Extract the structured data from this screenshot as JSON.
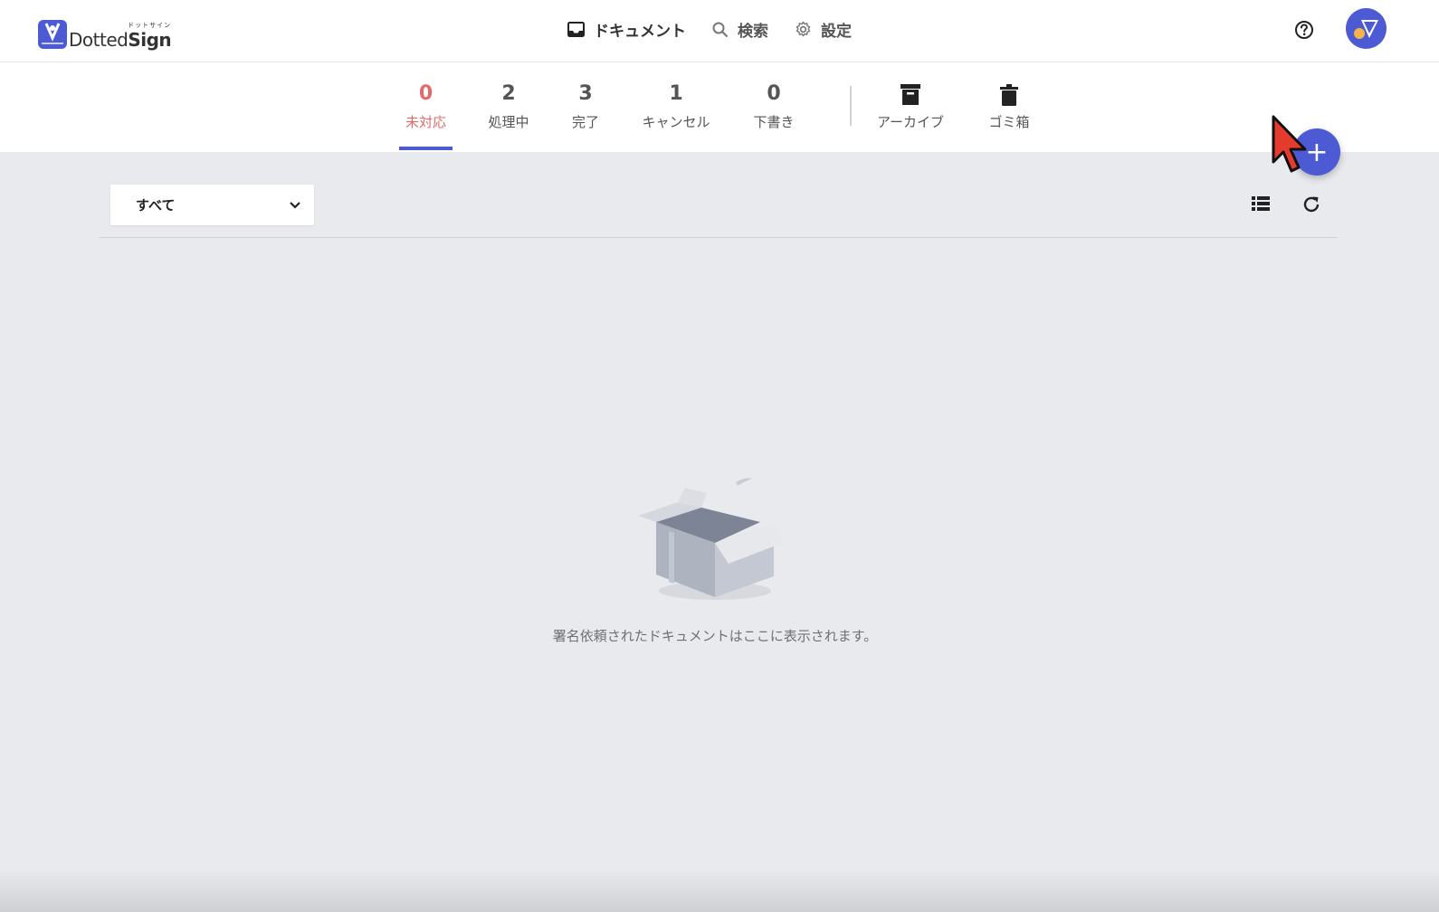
{
  "brand": {
    "kana": "ドットサイン",
    "word_light": "Dotted",
    "word_bold": "Sign"
  },
  "nav": {
    "documents": "ドキュメント",
    "search": "検索",
    "settings": "設定"
  },
  "tabs": [
    {
      "count": "0",
      "label": "未対応"
    },
    {
      "count": "2",
      "label": "処理中"
    },
    {
      "count": "3",
      "label": "完了"
    },
    {
      "count": "1",
      "label": "キャンセル"
    },
    {
      "count": "0",
      "label": "下書き"
    }
  ],
  "folders": [
    {
      "label": "アーカイブ",
      "icon": "archive-icon"
    },
    {
      "label": "ゴミ箱",
      "icon": "trash-icon"
    }
  ],
  "filter": {
    "selected": "すべて"
  },
  "fab": {
    "label": "+"
  },
  "empty_state": {
    "message": "署名依頼されたドキュメントはここに表示されます。"
  },
  "colors": {
    "accent": "#4c5bd4",
    "active_tab": "#e26a6a",
    "background": "#e9eaee"
  }
}
